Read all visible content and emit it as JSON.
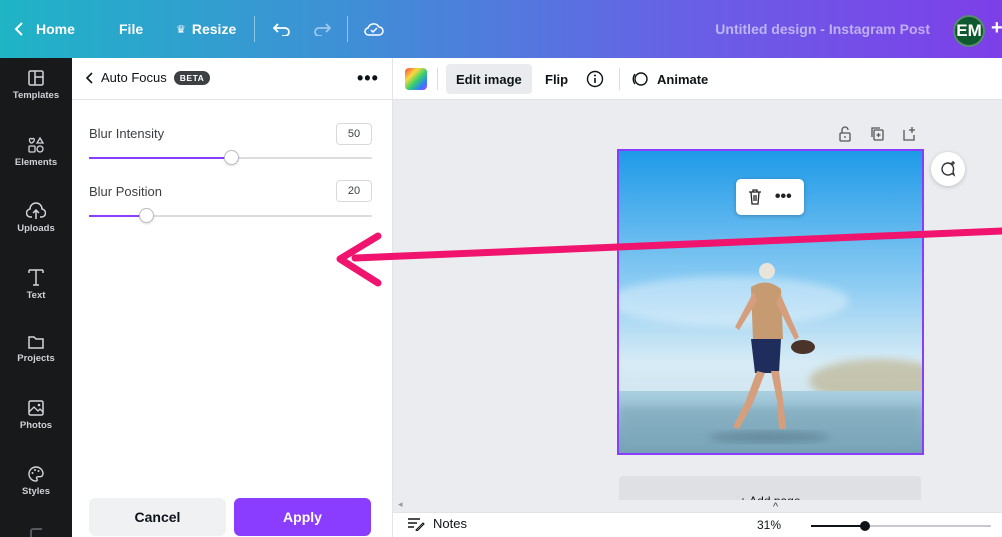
{
  "topbar": {
    "home_label": "Home",
    "file_label": "File",
    "resize_label": "Resize",
    "doc_title": "Untitled design - Instagram Post",
    "avatar_initials": "EM"
  },
  "sidebar": {
    "items": [
      {
        "label": "Templates",
        "icon": "templates-icon"
      },
      {
        "label": "Elements",
        "icon": "elements-icon"
      },
      {
        "label": "Uploads",
        "icon": "uploads-icon"
      },
      {
        "label": "Text",
        "icon": "text-icon"
      },
      {
        "label": "Projects",
        "icon": "folder-icon"
      },
      {
        "label": "Photos",
        "icon": "photos-icon"
      },
      {
        "label": "Styles",
        "icon": "palette-icon"
      }
    ]
  },
  "panel": {
    "title": "Auto Focus",
    "badge": "BETA",
    "blur_intensity_label": "Blur Intensity",
    "blur_intensity_value": "50",
    "blur_intensity_fraction": 0.5,
    "blur_position_label": "Blur Position",
    "blur_position_value": "20",
    "blur_position_fraction": 0.2,
    "cancel_label": "Cancel",
    "apply_label": "Apply"
  },
  "toolbar": {
    "edit_image_label": "Edit image",
    "flip_label": "Flip",
    "animate_label": "Animate"
  },
  "canvas": {
    "add_page_label": "+ Add page"
  },
  "bottombar": {
    "notes_label": "Notes",
    "zoom_label": "31%",
    "zoom_fraction": 0.3
  },
  "colors": {
    "accent": "#8b3dff",
    "annotation_arrow": "#f0146e",
    "sidebar_bg": "#18191b"
  }
}
